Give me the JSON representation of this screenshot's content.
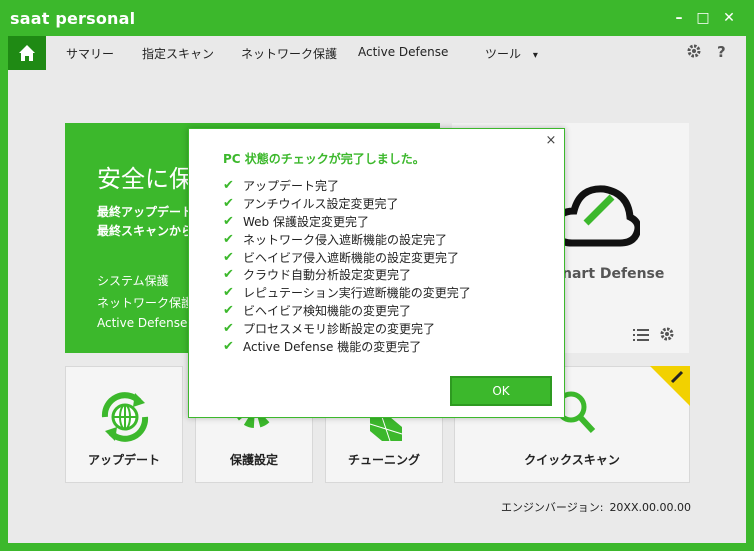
{
  "app": {
    "title": "saat personal",
    "controls": {
      "minimize": "–",
      "maximize": "□",
      "close": "✕"
    }
  },
  "nav": {
    "items": [
      "サマリー",
      "指定スキャン",
      "ネットワーク保護",
      "Active Defense",
      "ツール"
    ],
    "tools_arrow": "▾",
    "settings_icon": "gear-icon",
    "help_label": "?"
  },
  "status": {
    "headline": "安全に保",
    "last_update_label": "最終アップデートが",
    "last_scan_label": "最終スキャンから:",
    "items": [
      "システム保護",
      "ネットワーク保護",
      "Active Defense"
    ]
  },
  "cloud": {
    "label": "nart Defense"
  },
  "tiles": [
    {
      "label": "アップデート"
    },
    {
      "label": "保護設定"
    },
    {
      "label": "チューニング"
    },
    {
      "label": "クイックスキャン"
    }
  ],
  "engine": {
    "label": "エンジンバージョン:",
    "version": "20XX.00.00.00"
  },
  "dialog": {
    "title": "PC 状態のチェックが完了しました。",
    "items": [
      "アップデート完了",
      "アンチウイルス設定変更完了",
      "Web 保護設定変更完了",
      "ネットワーク侵入遮断機能の設定完了",
      "ビヘイビア侵入遮断機能の設定変更完了",
      "クラウド自動分析設定変更完了",
      "レピュテーション実行遮断機能の変更完了",
      "ビヘイビア検知機能の変更完了",
      "プロセスメモリ診断設定の変更完了",
      "Active Defense 機能の変更完了"
    ],
    "ok_label": "OK",
    "close_label": "×"
  },
  "colors": {
    "accent": "#3cb82c",
    "accent_dark": "#1f8a14",
    "panel_bg": "#eaeaea",
    "navbar_bg": "#e9e9e9"
  }
}
